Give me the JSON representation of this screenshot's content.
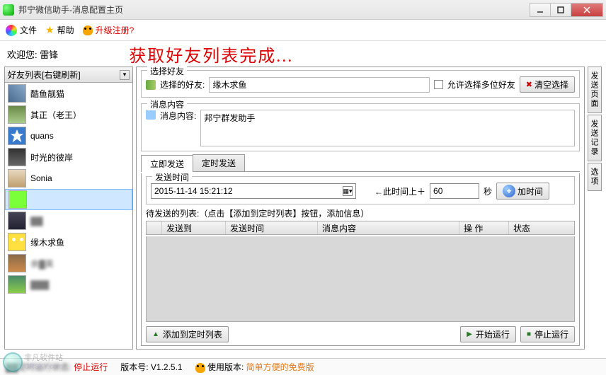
{
  "window": {
    "title": "邦宁微信助手-消息配置主页"
  },
  "toolbar": {
    "file": "文件",
    "help": "帮助",
    "upgrade": "升级注册?"
  },
  "welcome": {
    "label": "欢迎您: 雷锋",
    "status": "获取好友列表完成..."
  },
  "sidebar": {
    "header": "好友列表[右键刷新]",
    "items": [
      {
        "name": "酷鱼靓猫"
      },
      {
        "name": "其正（老王）"
      },
      {
        "name": "quans"
      },
      {
        "name": "时光的彼岸"
      },
      {
        "name": "Sonia"
      },
      {
        "name": ""
      },
      {
        "name": "▓▓"
      },
      {
        "name": "缘木求鱼"
      },
      {
        "name": "余▓英"
      },
      {
        "name": "▓▓▓"
      }
    ]
  },
  "select_friend": {
    "legend": "选择好友",
    "label": "选择的好友:",
    "value": "缘木求鱼",
    "allow_multi": "允许选择多位好友",
    "clear": "清空选择"
  },
  "message": {
    "legend": "消息内容",
    "label": "消息内容:",
    "value": "邦宁群发助手"
  },
  "tabs": {
    "now": "立即发送",
    "timed": "定时发送"
  },
  "schedule": {
    "legend": "发送时间",
    "datetime": "2015-11-14 15:21:12",
    "offset_label": "←此时间上＋",
    "offset_value": "60",
    "offset_unit": "秒",
    "add_time": "加时间",
    "pending_label": "待发送的列表:（点击【添加到定时列表】按钮，添加信息）",
    "cols": {
      "to": "发送到",
      "time": "发送时间",
      "content": "消息内容",
      "op": "操   作",
      "state": "状态"
    },
    "add_to_list": "添加到定时列表",
    "start": "开始运行",
    "stop": "停止运行"
  },
  "right_tabs": {
    "page": "发送页面",
    "log": "发送记录",
    "opt": "选项"
  },
  "statusbar": {
    "run_label": "▓▓定时运行状态:",
    "run_value": "停止运行",
    "ver_label": "版本号:",
    "ver_value": "V1.2.5.1",
    "edition_label": "使用版本:",
    "edition_value": "简单方便的免费版"
  },
  "watermark": {
    "line1": "非凡软件站",
    "line2": "CRSKY.com"
  }
}
